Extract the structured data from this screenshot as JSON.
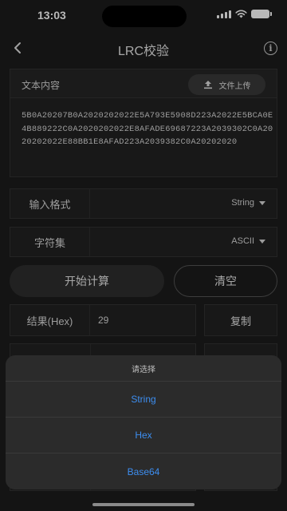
{
  "status_bar": {
    "time": "13:03"
  },
  "nav": {
    "title": "LRC校验",
    "back_icon": "chevron-left-icon",
    "info_icon": "info-icon",
    "info_glyph": "i"
  },
  "text_panel": {
    "label": "文本内容",
    "upload_label": "文件上传",
    "upload_icon": "upload-icon",
    "content": "5B0A20207B0A2020202022E5A793E5908D223A2022E5BCA0E4B889222C0A2020202022E8AFADE69687223A2039302C0A2020202022E88BB1E8AFAD223A2039382C0A20202020"
  },
  "input_format": {
    "label": "输入格式",
    "value": "String"
  },
  "charset": {
    "label": "字符集",
    "value": "ASCII"
  },
  "actions": {
    "start_label": "开始计算",
    "clear_label": "清空"
  },
  "result": {
    "label": "结果(Hex)",
    "value": "29",
    "copy_label": "复制"
  },
  "picker_sheet": {
    "title": "请选择",
    "options": [
      "String",
      "Hex",
      "Base64"
    ],
    "option_color": "#3d8ef0"
  }
}
